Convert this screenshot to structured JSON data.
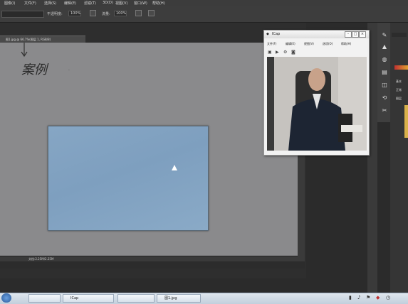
{
  "menubar": {
    "items": [
      "图像(I)",
      "文件(F)",
      "选择(S)",
      "编辑(E)",
      "滤镜(T)",
      "3D(D)",
      "视图(V)",
      "窗口(W)",
      "帮助(H)"
    ]
  },
  "options": {
    "opacity_label": "不透明度:",
    "opacity_value": "100%",
    "flow_label": "流量:",
    "flow_value": "100%"
  },
  "document": {
    "tab_label": "图1.jpg @ 66.7%(图层 1, RGB/8)",
    "handwriting": "案例",
    "status_text": "文档:2.25M/2.25M"
  },
  "webcam": {
    "title": "ICap",
    "menu": [
      "文件(F)",
      "编辑(E)",
      "视图(V)",
      "选项(O)",
      "帮助(H)"
    ]
  },
  "panels": {
    "label_1": "基本",
    "label_2": "正常",
    "label_3": "图层"
  },
  "taskbar": {
    "buttons": [
      "",
      "ICap",
      "",
      "图1.jpg"
    ]
  }
}
